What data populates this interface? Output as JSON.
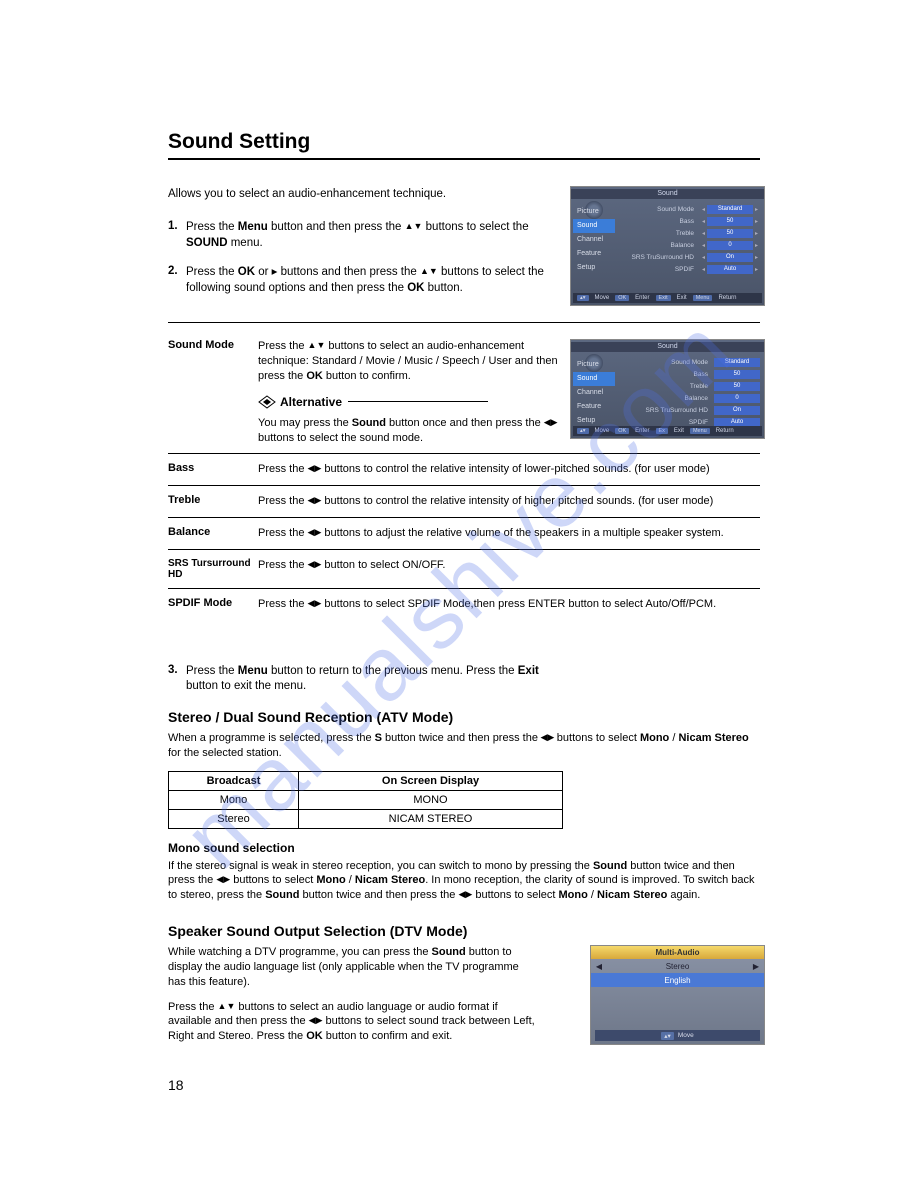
{
  "page_title": "Sound Setting",
  "intro": "Allows you to select an audio-enhancement technique.",
  "steps": {
    "s1_num": "1.",
    "s1_a": "Press the ",
    "s1_b": "Menu",
    "s1_c": " button and then press the ",
    "s1_d": " buttons to select the ",
    "s1_e": "SOUND",
    "s1_f": " menu.",
    "s2_num": "2.",
    "s2_a": "Press the ",
    "s2_b": "OK",
    "s2_c": " or ▸ buttons and  then  press  the  ",
    "s2_d": " buttons  to  select the  following sound  options and then press  the  ",
    "s2_e": "OK",
    "s2_f": "  button.",
    "s3_num": "3.",
    "s3_a": "Press the ",
    "s3_b": "Menu",
    "s3_c": " button to return to the previous menu. Press the  ",
    "s3_d": "Exit",
    "s3_e": "  button to exit the menu."
  },
  "osd": {
    "title": "Sound",
    "tabs": [
      "Picture",
      "Sound",
      "Channel",
      "Feature",
      "Setup"
    ],
    "rows": [
      {
        "label": "Sound Mode",
        "value": "Standard"
      },
      {
        "label": "Bass",
        "value": "50"
      },
      {
        "label": "Treble",
        "value": "50"
      },
      {
        "label": "Balance",
        "value": "0"
      },
      {
        "label": "SRS TruSurround HD",
        "value": "On"
      },
      {
        "label": "SPDIF",
        "value": "Auto"
      }
    ],
    "bottom": {
      "move": "Move",
      "ok": "OK",
      "enter": "Enter",
      "exit": "Exit",
      "menu": "Menu",
      "return": "Return"
    }
  },
  "defs": {
    "sound_mode_label": "Sound Mode",
    "sound_mode_a": "Press the ",
    "sound_mode_b": " buttons to select an audio-enhancement technique: Standard / Movie / Music / Speech / User and then press the ",
    "sound_mode_c": "OK",
    "sound_mode_d": " button to confirm.",
    "alternative_head": "Alternative",
    "alternative_a": "You may press the ",
    "alternative_b": "Sound",
    "alternative_c": " button once and then press the ",
    "alternative_d": " buttons to select the sound mode.",
    "bass_label": "Bass",
    "bass_a": "Press the ",
    "bass_b": " buttons to control the relative intensity of lower-pitched sounds. (for user mode)",
    "treble_label": "Treble",
    "treble_a": "Press the ",
    "treble_b": " buttons to control the relative intensity of higher pitched sounds. (for user mode)",
    "balance_label": "Balance",
    "balance_a": "Press the ",
    "balance_b": " buttons to adjust the relative volume of the speakers in a multiple speaker system.",
    "srs_label": "SRS Tursurround HD",
    "srs_a": "Press the ",
    "srs_b": "  button to select ON/OFF.",
    "spdif_label": "SPDIF Mode",
    "spdif_a": "Press the ",
    "spdif_b": " buttons to select SPDIF Mode,then press ENTER button to select Auto/Off/PCM."
  },
  "stereo_dual": {
    "heading": "Stereo / Dual Sound Reception (ATV Mode)",
    "p_a": "When a programme is selected, press the ",
    "p_b": "S",
    "p_c": " button twice and then press the",
    "p_d": " buttons to select ",
    "p_e": "Mono",
    "p_f": " / ",
    "p_g": "Nicam Stereo",
    "p_h": " for the selected station.",
    "th1": "Broadcast",
    "th2": "On Screen Display",
    "r1c1": "Mono",
    "r1c2": "MONO",
    "r2c1": "Stereo",
    "r2c2": "NICAM STEREO"
  },
  "mono": {
    "heading": "Mono sound selection",
    "a": "If the stereo signal is weak in stereo reception, you can switch to mono by pressing the ",
    "b": "Sound",
    "c": " button twice and then press the ",
    "d": " buttons to select ",
    "e": "Mono",
    "f": " / ",
    "g": "Nicam Stereo",
    "h": ". In mono reception, the clarity of sound is improved. To switch back to stereo, press the ",
    "i": "Sound",
    "j": " button twice and then press the ",
    "k": " buttons to select ",
    "l": "Mono",
    "m": " / ",
    "n": "Nicam Stereo",
    "o": " again."
  },
  "dtv": {
    "heading": "Speaker Sound Output Selection (DTV Mode)",
    "p1_a": "While watching a DTV programme, you can press the ",
    "p1_b": "Sound",
    "p1_c": " button to display the audio language list (only applicable when the TV programme has this feature).",
    "p2_a": "Press the ",
    "p2_b": " buttons to select an audio language or audio format if available and then press the ",
    "p2_c": " buttons to select sound track between  Left, Right and Stereo. Press the ",
    "p2_d": "OK",
    "p2_e": " button to confirm and exit."
  },
  "multi_audio": {
    "title": "Multi-Audio",
    "row1": "Stereo",
    "row2": "English",
    "move": "Move"
  },
  "page_number": "18",
  "watermark": "manualshive.com"
}
